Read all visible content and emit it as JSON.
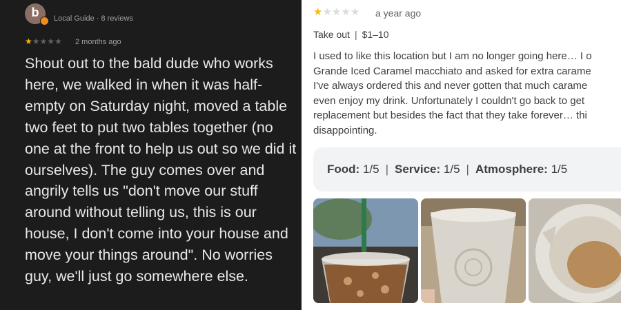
{
  "left_review": {
    "avatar_letter": "b",
    "reviewer_meta": "Local Guide · 8 reviews",
    "stars_filled": 1,
    "stars_total": 5,
    "time_ago": "2 months ago",
    "body": "Shout out to the bald dude who works here, we walked in when it was half-empty on Saturday night, moved a table two feet to put two tables together (no one at the front to help us out so we did it ourselves). The guy comes over and angrily tells us \"don't move our stuff around without telling us, this is our house, I don't come into your house and move your things around\". No worries guy, we'll just go somewhere else."
  },
  "right_review": {
    "stars_filled": 1,
    "stars_total": 5,
    "time_ago": "a year ago",
    "tag_service": "Take out",
    "tag_price": "$1–10",
    "body_lines": [
      "I used to like this location but I am no longer going here… I o",
      "Grande Iced Caramel macchiato and asked for extra carame",
      "I've always ordered this and never gotten that much carame",
      "even enjoy my drink. Unfortunately I couldn't go back to get",
      "replacement but besides the fact that they take forever… thi",
      "disappointing."
    ],
    "ratings": {
      "food_label": "Food:",
      "food_value": "1/5",
      "service_label": "Service:",
      "service_value": "1/5",
      "atmosphere_label": "Atmosphere:",
      "atmosphere_value": "1/5"
    }
  },
  "colors": {
    "star": "#fbbc04",
    "dark_bg": "#1c1c1c",
    "rating_box": "#f1f3f4"
  }
}
